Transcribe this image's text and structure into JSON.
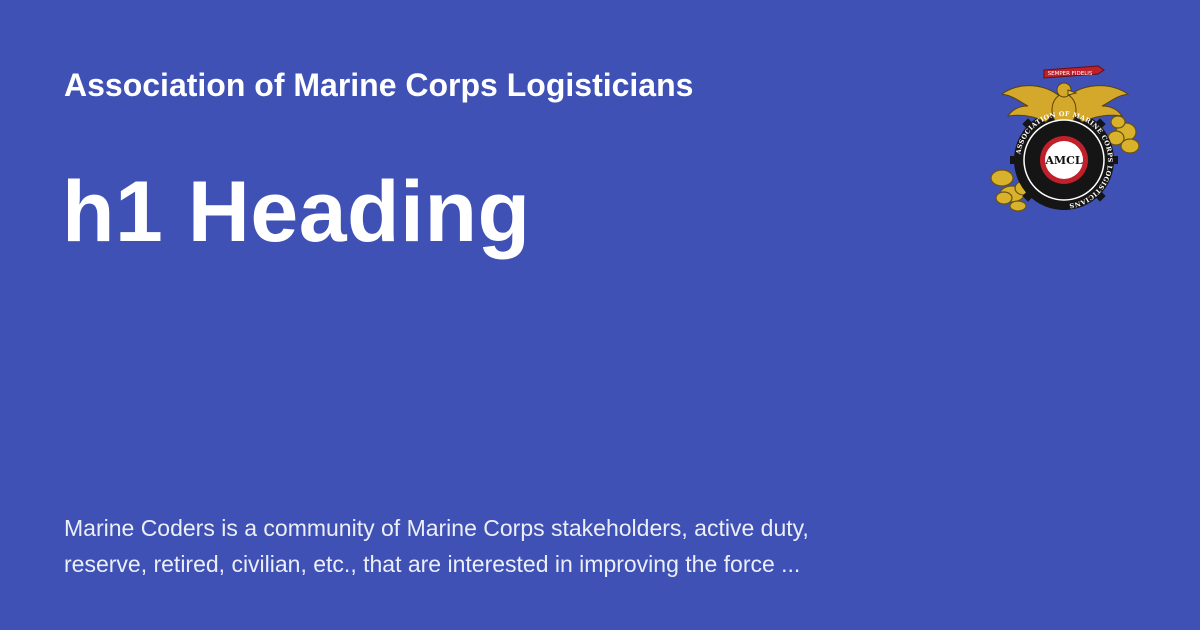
{
  "site": {
    "name": "Association of Marine Corps Logisticians"
  },
  "page": {
    "title": "h1 Heading",
    "description": "Marine Coders is a community of Marine Corps stakeholders, active duty, reserve, retired, civilian, etc., that are interested in improving the force ..."
  },
  "logo": {
    "icon": "amcl-emblem-icon",
    "center_text": "AMCL",
    "ring_text": "ASSOCIATION OF MARINE CORPS LOGISTICIANS",
    "banner_text": "SEMPER FIDELIS"
  },
  "colors": {
    "background": "#3f51b5",
    "text": "#ffffff",
    "emblem_gold": "#d4a82a",
    "emblem_black": "#111111",
    "emblem_red": "#c0202a"
  }
}
